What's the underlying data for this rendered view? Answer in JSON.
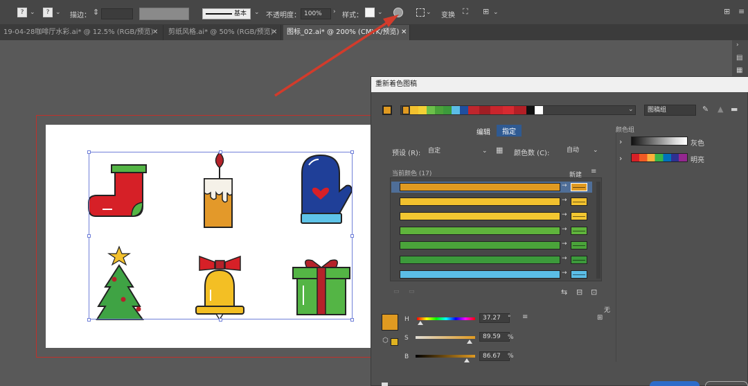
{
  "toolbar": {
    "stroke_label": "描边：",
    "stroke_profile": "基本",
    "opacity_label": "不透明度：",
    "opacity_value": "100%",
    "style_label": "样式：",
    "transform_label": "变换"
  },
  "tabs": [
    {
      "label": "19-04-28咖啡厅水彩.ai* @ 12.5% (RGB/预览)",
      "close": "✕"
    },
    {
      "label": "剪纸风格.ai* @ 50% (RGB/预览)",
      "close": "✕"
    },
    {
      "label": "图标_02.ai* @ 200% (CMYK/预览)",
      "close": "✕"
    }
  ],
  "dialog": {
    "title": "重新着色图稿",
    "group_name": "图稿组",
    "tab_edit": "编辑",
    "tab_assign": "指定",
    "preset_label": "预设 (R):",
    "preset_value": "自定",
    "color_count_label": "颜色数 (C):",
    "color_count_value": "自动",
    "current_colors_label": "当前颜色 (17)",
    "new_label": "新建",
    "color_groups_label": "颜色组",
    "group_gray": "灰色",
    "group_bright": "明亮",
    "none_label": "无",
    "h_label": "H",
    "s_label": "S",
    "b_label": "B",
    "h_value": "37.27",
    "h_unit": "°",
    "s_value": "89.59",
    "s_unit": "%",
    "b_value": "86.67",
    "b_unit": "%"
  },
  "colors": {
    "accent_arrow": "#d23b2b",
    "selection": "#6f7fd8",
    "rows": [
      "#e09a21",
      "#f2c12e",
      "#f3c731",
      "#5fb43c",
      "#4aa33a",
      "#3c9a3b",
      "#5bbde6"
    ]
  }
}
